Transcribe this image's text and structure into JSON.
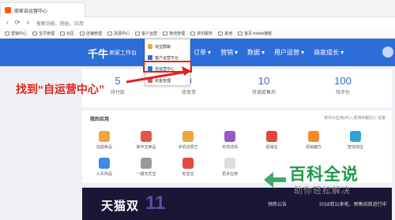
{
  "browser": {
    "tab_title": "商家自运营中心",
    "address_placeholder": "搜索功能、网址、应用"
  },
  "bookmarks": [
    "营销中心",
    "宝贝管理",
    "社区",
    "店铺管理",
    "货源中心",
    "客户运营",
    "物流管理",
    "资讯服务",
    "其他",
    "首页-holtek捷钜"
  ],
  "header": {
    "logo": "千牛",
    "logo_sub": "卖家工作台",
    "nav": [
      "订单",
      "营销",
      "数据",
      "用户运营",
      "商家成长"
    ]
  },
  "dropdown": {
    "items": [
      "淘宝群聊",
      "客户运营平台",
      "自运营中心",
      "资金管理"
    ],
    "highlighted_index": 2
  },
  "annotation": "找到“自运营中心”",
  "stats": [
    {
      "num": "5",
      "label": "待付款"
    },
    {
      "num": "0",
      "label": "待发货"
    },
    {
      "num": "10",
      "label": "待退款售后"
    },
    {
      "num": "100",
      "label": "待评价"
    }
  ],
  "apps": {
    "title": "我的应用",
    "right": "待评价应用(41) | 即将到期(2) | 设置",
    "items": [
      {
        "label": "拍拍卖品",
        "color": "#f2a63b"
      },
      {
        "label": "掌中宝卖品",
        "color": "#e1554a"
      },
      {
        "label": "手机详情王",
        "color": "#f0a541"
      },
      {
        "label": "无线详情",
        "color": "#9a57c8"
      },
      {
        "label": "促销宝",
        "color": "#e2453d"
      },
      {
        "label": "促销魔方",
        "color": "#f08c2e"
      },
      {
        "label": "智淘淘宝",
        "color": "#2fa3d9"
      },
      {
        "label": "火车商品",
        "color": "#3b8be0"
      },
      {
        "label": "一键无忧宝",
        "color": "#999999"
      },
      {
        "label": "旺店宝",
        "color": "#e44a3c"
      },
      {
        "label": "更多应用",
        "color": "#dddddd"
      }
    ]
  },
  "banner": {
    "logo": "天猫双",
    "logo_num": "11",
    "notice_label": "预热公告",
    "notice_text": "2018双11来啦，预售招商进行中"
  },
  "watermark": {
    "main": "百科全说",
    "sub": "助你轻松解决"
  }
}
